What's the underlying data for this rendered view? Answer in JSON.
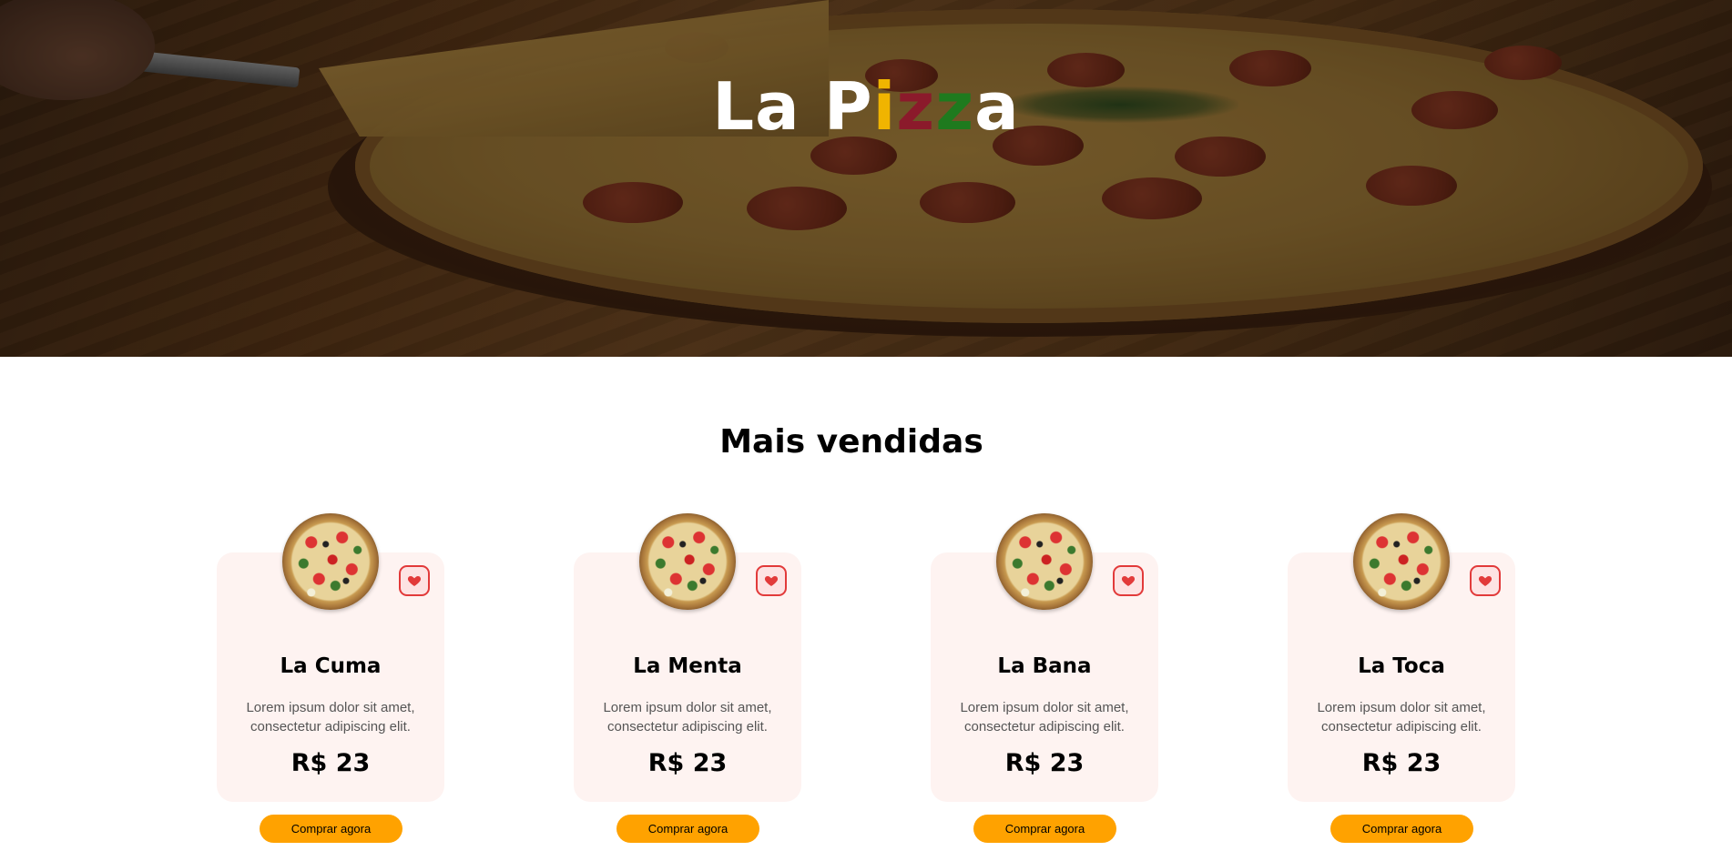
{
  "hero": {
    "title_parts": [
      {
        "text": "La P",
        "color": "#ffffff"
      },
      {
        "text": "i",
        "color": "#f0b400"
      },
      {
        "text": "z",
        "color": "#8b1a2b"
      },
      {
        "text": "z",
        "color": "#1e7a1e"
      },
      {
        "text": "a",
        "color": "#ffffff"
      }
    ],
    "background_image": "pepperoni-pizza-photo"
  },
  "section": {
    "title": "Mais vendidas"
  },
  "products": [
    {
      "name": "La Cuma",
      "description": "Lorem ipsum dolor sit amet, consectetur adipiscing elit.",
      "price": "R$ 23",
      "button_label": "Comprar agora",
      "favorite_icon": "heart-icon"
    },
    {
      "name": "La Menta",
      "description": "Lorem ipsum dolor sit amet, consectetur adipiscing elit.",
      "price": "R$ 23",
      "button_label": "Comprar agora",
      "favorite_icon": "heart-icon"
    },
    {
      "name": "La Bana",
      "description": "Lorem ipsum dolor sit amet, consectetur adipiscing elit.",
      "price": "R$ 23",
      "button_label": "Comprar agora",
      "favorite_icon": "heart-icon"
    },
    {
      "name": "La Toca",
      "description": "Lorem ipsum dolor sit amet, consectetur adipiscing elit.",
      "price": "R$ 23",
      "button_label": "Comprar agora",
      "favorite_icon": "heart-icon"
    }
  ],
  "colors": {
    "accent": "#ffa200",
    "card_background": "#fef3f1",
    "favorite": "#e23a3a"
  }
}
